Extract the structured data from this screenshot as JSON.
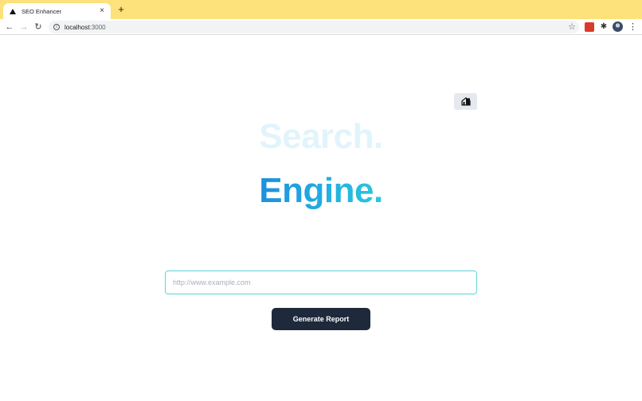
{
  "browser": {
    "tab": {
      "title": "SEO Enhancer",
      "close_glyph": "×",
      "favicon": "triangle-icon"
    },
    "new_tab_glyph": "+",
    "nav": {
      "back_glyph": "←",
      "forward_glyph": "→",
      "reload_glyph": "↻"
    },
    "address": {
      "host": "localhost",
      "port": ":3000"
    },
    "icons": {
      "info": "i",
      "star": "☆",
      "puzzle": "✱",
      "menu": "⋮"
    },
    "tabstrip_color": "#fde17a"
  },
  "page": {
    "heading_line1": "Search.",
    "heading_line2": "Engine.",
    "url_input": {
      "value": "",
      "placeholder": "http://www.example.com"
    },
    "generate_button_label": "Generate Report",
    "colors": {
      "heading_faded": "#e1f4fc",
      "heading_gradient_start": "#1d8fdc",
      "heading_gradient_end": "#2bc8d9",
      "input_border": "#5ad6d8",
      "button_bg": "#1e293b",
      "toggle_bg": "#e5e9ef"
    },
    "theme_toggle_icon": "dark-mode-house-icon"
  }
}
